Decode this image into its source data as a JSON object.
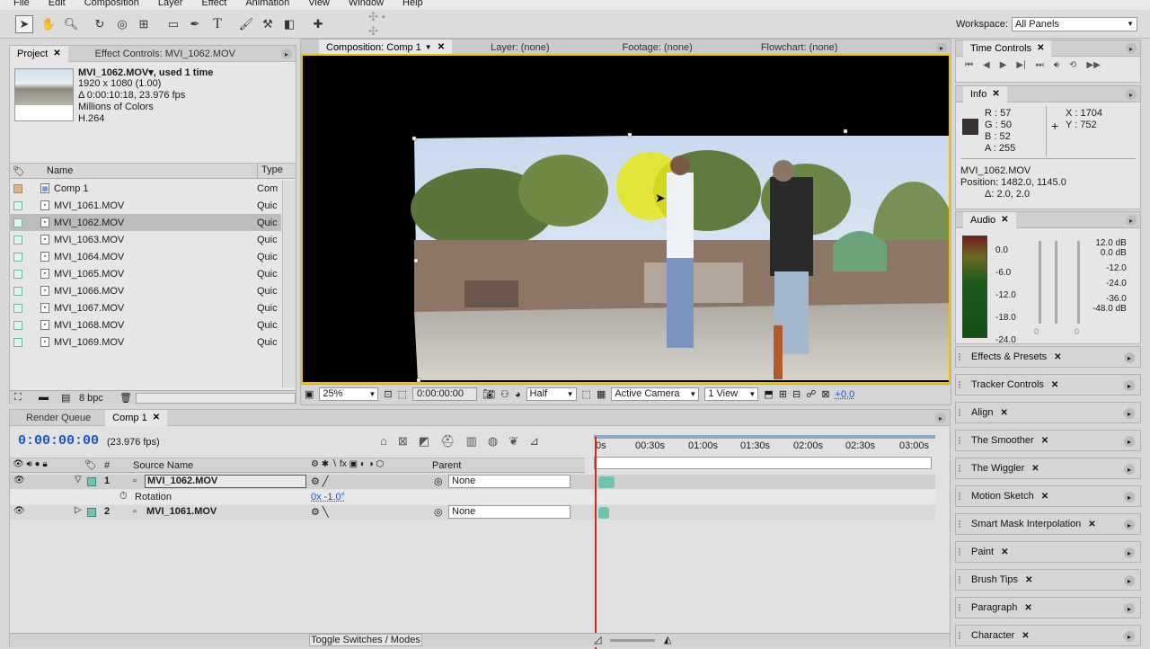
{
  "menu": [
    "File",
    "Edit",
    "Composition",
    "Layer",
    "Effect",
    "Animation",
    "View",
    "Window",
    "Help"
  ],
  "workspace": {
    "label": "Workspace:",
    "value": "All Panels"
  },
  "project": {
    "tabs": [
      "Project",
      "Effect Controls: MVI_1062.MOV"
    ],
    "selected_name": "MVI_1062.MOV▾, used 1 time",
    "info_lines": [
      "1920 x 1080 (1.00)",
      "Δ 0:00:10:18, 23.976 fps",
      "Millions of Colors",
      "H.264"
    ],
    "col_name": "Name",
    "col_type": "Type",
    "items": [
      {
        "name": "Comp 1",
        "type": "Com",
        "kind": "comp"
      },
      {
        "name": "MVI_1061.MOV",
        "type": "Quic",
        "kind": "file"
      },
      {
        "name": "MVI_1062.MOV",
        "type": "Quic",
        "kind": "file",
        "selected": true
      },
      {
        "name": "MVI_1063.MOV",
        "type": "Quic",
        "kind": "file"
      },
      {
        "name": "MVI_1064.MOV",
        "type": "Quic",
        "kind": "file"
      },
      {
        "name": "MVI_1065.MOV",
        "type": "Quic",
        "kind": "file"
      },
      {
        "name": "MVI_1066.MOV",
        "type": "Quic",
        "kind": "file"
      },
      {
        "name": "MVI_1067.MOV",
        "type": "Quic",
        "kind": "file"
      },
      {
        "name": "MVI_1068.MOV",
        "type": "Quic",
        "kind": "file"
      },
      {
        "name": "MVI_1069.MOV",
        "type": "Quic",
        "kind": "file"
      }
    ],
    "bpc": "8 bpc"
  },
  "viewer": {
    "tabs": [
      "Composition: Comp 1",
      "Layer: (none)",
      "Footage: (none)",
      "Flowchart: (none)"
    ],
    "zoom": "25%",
    "timecode": "0:00:00:00",
    "resolution": "Half",
    "camera": "Active Camera",
    "views": "1 View",
    "exposure": "+0.0"
  },
  "timeline": {
    "tabs": [
      "Render Queue",
      "Comp 1"
    ],
    "current_time": "0:00:00:00",
    "fps": "(23.976 fps)",
    "col_source": "Source Name",
    "col_parent": "Parent",
    "col_num": "#",
    "ruler": [
      "0s",
      "00:30s",
      "01:00s",
      "01:30s",
      "02:00s",
      "02:30s",
      "03:00s"
    ],
    "layers": [
      {
        "num": "1",
        "name": "MVI_1062.MOV",
        "parent": "None"
      },
      {
        "num": "2",
        "name": "MVI_1061.MOV",
        "parent": "None"
      }
    ],
    "prop": {
      "name": "Rotation",
      "value": "0x -1.0°"
    },
    "toggle": "Toggle Switches / Modes"
  },
  "timecontrols": {
    "title": "Time Controls"
  },
  "info": {
    "title": "Info",
    "r": "R : 57",
    "g": "G : 50",
    "b": "B : 52",
    "a": "A : 255",
    "x": "X : 1704",
    "y": "Y : 752",
    "line1": "MVI_1062.MOV",
    "line2": "Position: 1482.0, 1145.0",
    "line3": "Δ: 2.0, 2.0",
    "swatch": "#393234"
  },
  "audio": {
    "title": "Audio",
    "left": [
      "0.0",
      "-6.0",
      "-12.0",
      "-18.0",
      "-24.0"
    ],
    "right": [
      "12.0 dB",
      "0.0 dB",
      "-12.0",
      "-24.0",
      "-36.0",
      "-48.0 dB"
    ],
    "zero1": "0",
    "zero2": "0"
  },
  "panels": [
    "Effects & Presets",
    "Tracker Controls",
    "Align",
    "The Smoother",
    "The Wiggler",
    "Motion Sketch",
    "Smart Mask Interpolation",
    "Paint",
    "Brush Tips",
    "Paragraph",
    "Character"
  ],
  "colors": {
    "accent_blue": "#1a55c8",
    "comp_border": "#f2c000",
    "label_teal": "#6fc2ae",
    "playhead": "#d22"
  }
}
